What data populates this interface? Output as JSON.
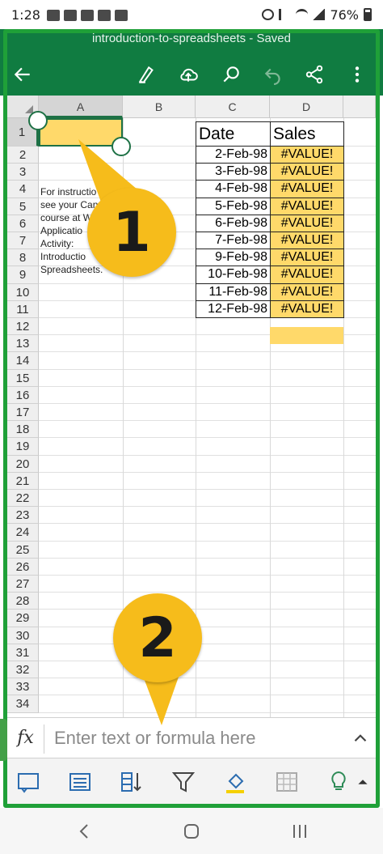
{
  "status_bar": {
    "time": "1:28",
    "battery": "76%"
  },
  "doc": {
    "title": "introduction-to-spreadsheets - Saved"
  },
  "toolbar": {
    "back_icon": "arrow-left-icon",
    "draw_icon": "pen-draw-icon",
    "cloud_icon": "cloud-upload-icon",
    "search_icon": "search-icon",
    "undo_icon": "undo-icon",
    "share_icon": "share-icon",
    "more_icon": "more-vertical-icon"
  },
  "columns": [
    "A",
    "B",
    "C",
    "D"
  ],
  "rows": [
    "1",
    "2",
    "3",
    "4",
    "5",
    "6",
    "7",
    "8",
    "9",
    "10",
    "11",
    "12",
    "13",
    "14",
    "15",
    "16",
    "17",
    "18",
    "19",
    "20",
    "21",
    "22",
    "23",
    "24",
    "25",
    "26",
    "27",
    "28",
    "29",
    "30",
    "31",
    "32",
    "33",
    "34"
  ],
  "instructions": [
    "For instructio",
    "see your Can",
    "course at W",
    "Applicatio",
    "Activity:",
    "Introductio",
    "Spreadsheets."
  ],
  "table": {
    "headers": {
      "date": "Date",
      "sales": "Sales"
    },
    "dates": [
      "2-Feb-98",
      "3-Feb-98",
      "4-Feb-98",
      "5-Feb-98",
      "6-Feb-98",
      "7-Feb-98",
      "9-Feb-98",
      "10-Feb-98",
      "11-Feb-98",
      "12-Feb-98"
    ],
    "sales": [
      "#VALUE!",
      "#VALUE!",
      "#VALUE!",
      "#VALUE!",
      "#VALUE!",
      "#VALUE!",
      "#VALUE!",
      "#VALUE!",
      "#VALUE!",
      "#VALUE!"
    ]
  },
  "callouts": {
    "one": "1",
    "two": "2"
  },
  "formula_bar": {
    "fx_label": "fx",
    "placeholder": "Enter text or formula here"
  },
  "colors": {
    "header_green": "#107c41",
    "frame_green": "#1fa038",
    "highlight": "#ffd96a",
    "callout": "#f6bc1b"
  },
  "bottom_toolbar": [
    "comment-icon",
    "card-view-icon",
    "sort-icon",
    "filter-icon",
    "fill-color-icon",
    "insert-image-icon",
    "lightbulb-icon",
    "chevron-up-icon"
  ],
  "navbar": [
    "back-nav-icon",
    "home-nav-icon",
    "recents-nav-icon"
  ]
}
